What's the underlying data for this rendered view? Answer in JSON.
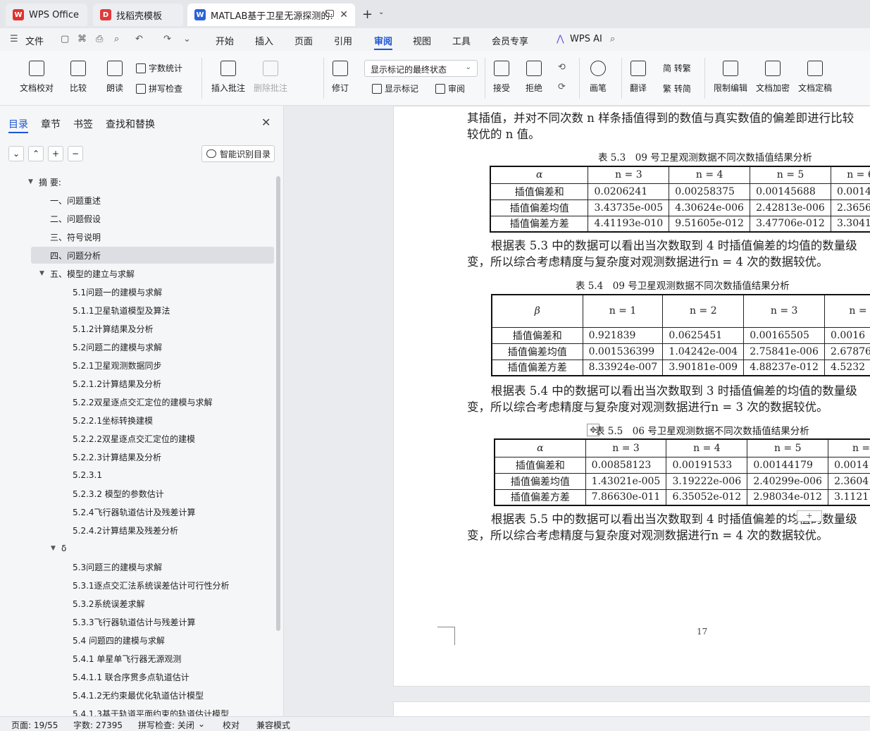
{
  "tabs": [
    {
      "label": "WPS Office",
      "icon": "wps-logo-icon",
      "color": "#e0322d"
    },
    {
      "label": "找稻壳模板",
      "icon": "docer-logo-icon",
      "color": "#e03a3a"
    },
    {
      "label": "MATLAB基于卫星无源探测的:",
      "icon": "word-doc-icon",
      "color": "#2b62d9"
    }
  ],
  "menu": {
    "file": "文件",
    "items": [
      "开始",
      "插入",
      "页面",
      "引用",
      "审阅",
      "视图",
      "工具",
      "会员专享"
    ],
    "active": "审阅",
    "ai": "WPS AI"
  },
  "ribbon": {
    "doc_check": "文档校对",
    "compare": "比较",
    "read": "朗读",
    "word_count": "字数统计",
    "spell_check": "拼写检查",
    "insert_comment": "插入批注",
    "delete_comment": "删除批注",
    "revise": "修订",
    "markup_select": "显示标记的最终状态",
    "show_markup": "显示标记",
    "review": "审阅",
    "accept": "接受",
    "reject": "拒绝",
    "pen": "画笔",
    "translate": "翻译",
    "to_traditional": "简 转繁",
    "to_simplified": "繁 转简",
    "restrict_edit": "限制编辑",
    "encrypt": "文档加密",
    "finalize": "文档定稿"
  },
  "sidebar": {
    "tabs": [
      "目录",
      "章节",
      "书签",
      "查找和替换"
    ],
    "smart_button": "智能识别目录",
    "toc": [
      {
        "label": "摘 要:",
        "level": 0,
        "expanded": true
      },
      {
        "label": "一、问题重述",
        "level": 1
      },
      {
        "label": "二、问题假设",
        "level": 1
      },
      {
        "label": "三、符号说明",
        "level": 1
      },
      {
        "label": "四、问题分析",
        "level": 1,
        "selected": true
      },
      {
        "label": "五、模型的建立与求解",
        "level": 0.5,
        "expanded": true
      },
      {
        "label": "5.1问题一的建模与求解",
        "level": 2
      },
      {
        "label": "5.1.1卫星轨道模型及算法",
        "level": 2
      },
      {
        "label": "5.1.2计算结果及分析",
        "level": 2
      },
      {
        "label": "5.2问题二的建模与求解",
        "level": 2
      },
      {
        "label": "5.2.1卫星观测数据同步",
        "level": 2
      },
      {
        "label": "5.2.1.2计算结果及分析",
        "level": 2
      },
      {
        "label": "5.2.2双星逐点交汇定位的建模与求解",
        "level": 2
      },
      {
        "label": "5.2.2.1坐标转换建模",
        "level": 2
      },
      {
        "label": "5.2.2.2双星逐点交汇定位的建模",
        "level": 2
      },
      {
        "label": "5.2.2.3计算结果及分析",
        "level": 2
      },
      {
        "label": "5.2.3.1",
        "level": 2
      },
      {
        "label": "5.2.3.2 模型的参数估计",
        "level": 2
      },
      {
        "label": "5.2.4飞行器轨道估计及残差计算",
        "level": 2
      },
      {
        "label": "5.2.4.2计算结果及残差分析",
        "level": 2
      },
      {
        "label": "δ",
        "level": 1.2,
        "expanded": true
      },
      {
        "label": "5.3问题三的建模与求解",
        "level": 2
      },
      {
        "label": "5.3.1逐点交汇法系统误差估计可行性分析",
        "level": 2
      },
      {
        "label": "5.3.2系统误差求解",
        "level": 2
      },
      {
        "label": "5.3.3飞行器轨道估计与残差计算",
        "level": 2
      },
      {
        "label": "5.4 问题四的建模与求解",
        "level": 2
      },
      {
        "label": "5.4.1 单星单飞行器无源观测",
        "level": 2
      },
      {
        "label": "5.4.1.1 联合序贯多点轨道估计",
        "level": 2
      },
      {
        "label": "5.4.1.2无约束最优化轨道估计模型",
        "level": 2
      },
      {
        "label": "5.4.1.3基于轨道平面约束的轨道估计模型",
        "level": 2
      }
    ]
  },
  "document": {
    "para0_l1": "其插值，并对不同次数 n 样条插值得到的数值与真实数值的偏差即进行比较",
    "para0_l2": "较优的 n 值。",
    "table1": {
      "caption": "表 5.3　09 号卫星观测数据不同次数插值结果分析",
      "header": [
        "α",
        "n = 3",
        "n = 4",
        "n = 5",
        "n = 6"
      ],
      "rows": [
        [
          "插值偏差和",
          "0.0206241",
          "0.00258375",
          "0.00145688",
          "0.0014"
        ],
        [
          "插值偏差均值",
          "3.43735e-005",
          "4.30624e-006",
          "2.42813e-006",
          "2.3656"
        ],
        [
          "插值偏差方差",
          "4.41193e-010",
          "9.51605e-012",
          "3.47706e-012",
          "3.3041"
        ]
      ]
    },
    "para1_l1": "根据表 5.3 中的数据可以看出当次数取到 4 时插值偏差的均值的数量级",
    "para1_l2": "变，所以综合考虑精度与复杂度对观测数据进行n = 4 次的数据较优。",
    "table2": {
      "caption": "表 5.4　09 号卫星观测数据不同次数插值结果分析",
      "header": [
        "β",
        "n = 1",
        "n = 2",
        "n = 3",
        "n ="
      ],
      "rows": [
        [
          "插值偏差和",
          "0.921839",
          "0.0625451",
          "0.00165505",
          "0.0016"
        ],
        [
          "插值偏差均值",
          "0.001536399",
          "1.04242e-004",
          "2.75841e-006",
          "2.67876"
        ],
        [
          "插值偏差方差",
          "8.33924e-007",
          "3.90181e-009",
          "4.88237e-012",
          "4.5232"
        ]
      ]
    },
    "para2_l1": "根据表 5.4 中的数据可以看出当次数取到 3 时插值偏差的均值的数量级",
    "para2_l2": "变，所以综合考虑精度与复杂度对观测数据进行n = 3 次的数据较优。",
    "table3": {
      "caption": "表 5.5　06 号卫星观测数据不同次数插值结果分析",
      "header": [
        "α",
        "n = 3",
        "n = 4",
        "n = 5",
        "n ="
      ],
      "rows": [
        [
          "插值偏差和",
          "0.00858123",
          "0.00191533",
          "0.00144179",
          "0.0014"
        ],
        [
          "插值偏差均值",
          "1.43021e-005",
          "3.19222e-006",
          "2.40299e-006",
          "2.3604"
        ],
        [
          "插值偏差方差",
          "7.86630e-011",
          "6.35052e-012",
          "2.98034e-012",
          "3.1121"
        ]
      ]
    },
    "para3_l1": "根据表 5.5 中的数据可以看出当次数取到 4 时插值偏差的均值的数量级",
    "para3_l2": "变，所以综合考虑精度与复杂度对观测数据进行n = 4 次的数据较优。",
    "page_number": "17"
  },
  "status": {
    "page": "页面: 19/55",
    "words": "字数: 27395",
    "spell": "拼写检查: 关闭",
    "proof": "校对",
    "compat": "兼容模式"
  }
}
